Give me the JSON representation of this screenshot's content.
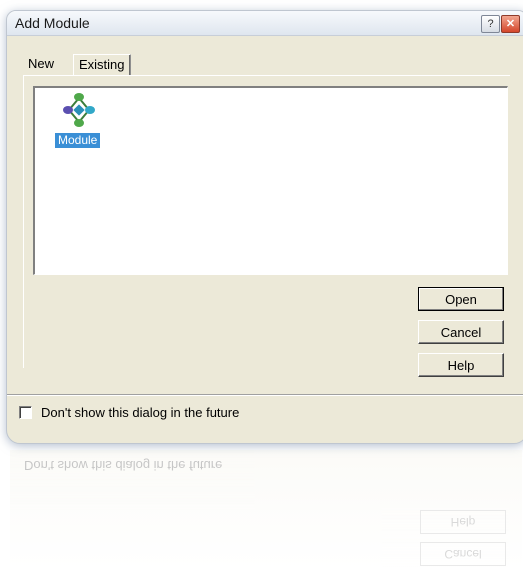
{
  "window": {
    "title": "Add Module",
    "help_glyph": "?",
    "close_glyph": "✕"
  },
  "tabs": [
    {
      "label": "New",
      "selected": true
    },
    {
      "label": "Existing",
      "selected": false
    }
  ],
  "items": [
    {
      "label": "Module",
      "icon": "module-icon",
      "selected": true
    }
  ],
  "buttons": {
    "open": "Open",
    "cancel": "Cancel",
    "help": "Help"
  },
  "checkbox": {
    "label": "Don't show this dialog in the future",
    "checked": false
  },
  "colors": {
    "selection": "#3a8fd6",
    "dialog_bg": "#ece9d8"
  }
}
